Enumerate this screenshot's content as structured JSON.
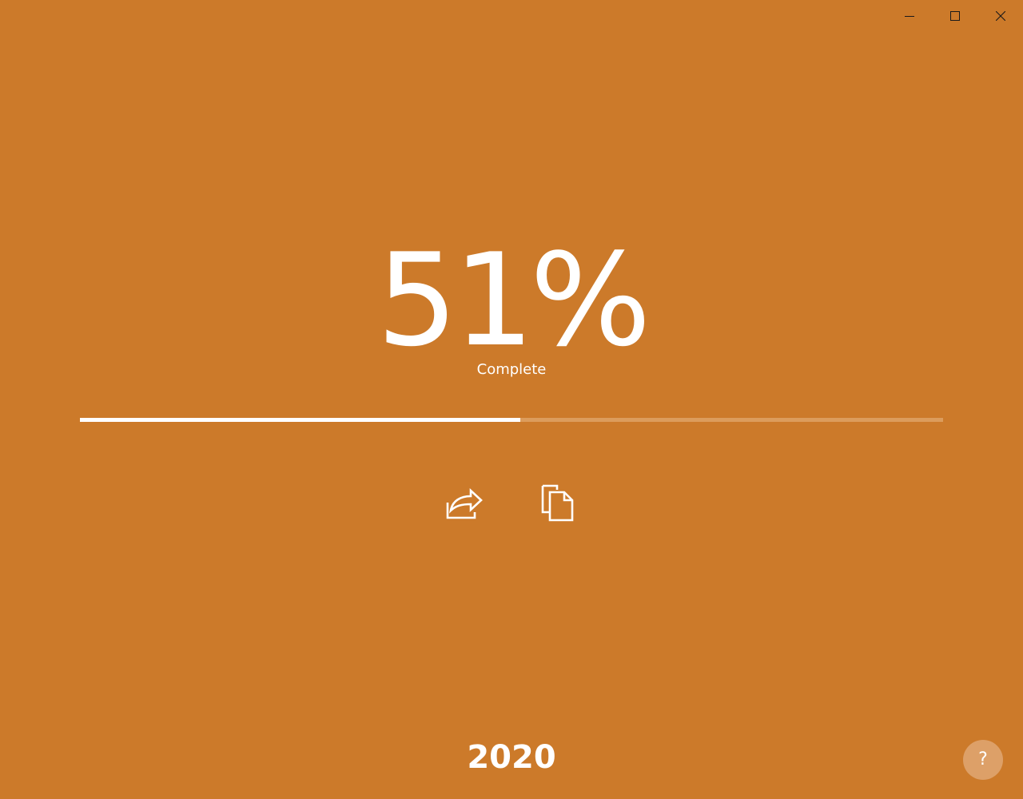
{
  "window": {
    "caption_buttons": [
      {
        "name": "minimize",
        "icon": "minimize-icon"
      },
      {
        "name": "maximize",
        "icon": "maximize-icon"
      },
      {
        "name": "close",
        "icon": "close-icon"
      }
    ]
  },
  "progress": {
    "percent_text": "51%",
    "label": "Complete",
    "value": 0.51
  },
  "actions": {
    "share_icon": "share-icon",
    "copy_icon": "copy-icon"
  },
  "year": "2020",
  "help": {
    "label": "?"
  },
  "colors": {
    "background": "#CC7A2A",
    "progress_fill": "#FFFFFF",
    "progress_track": "#DC9C5C",
    "help_button": "#DDA068",
    "text": "#FFFFFF"
  }
}
